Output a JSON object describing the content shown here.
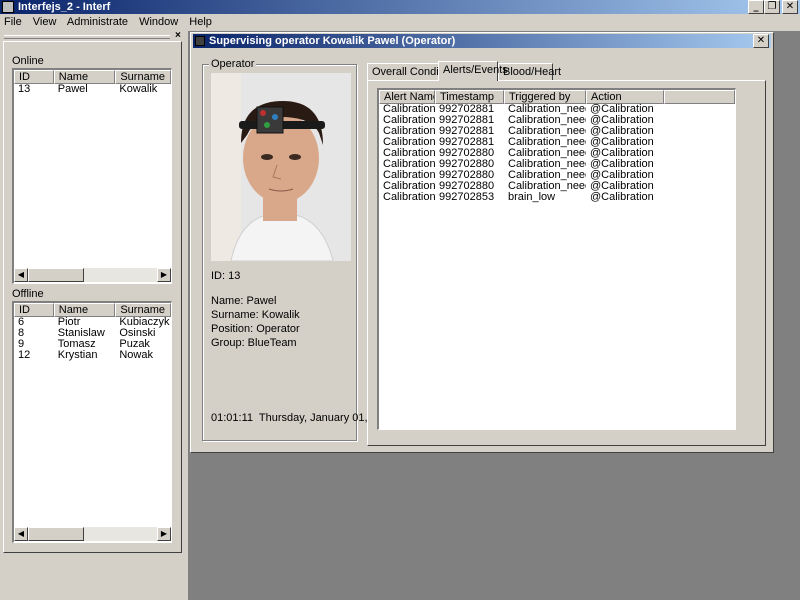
{
  "app": {
    "title": "Interfejs_2 - Interf",
    "controls": [
      "_",
      "❐",
      "✕"
    ]
  },
  "menu": {
    "file": "File",
    "view": "View",
    "administrate": "Administrate",
    "window": "Window",
    "help": "Help"
  },
  "sidebar": {
    "close": "×",
    "online": {
      "label": "Online",
      "columns": [
        "ID",
        "Name",
        "Surname"
      ],
      "rows": [
        {
          "id": "13",
          "name": "Pawel",
          "surname": "Kowalik"
        }
      ]
    },
    "offline": {
      "label": "Offline",
      "columns": [
        "ID",
        "Name",
        "Surname"
      ],
      "rows": [
        {
          "id": "6",
          "name": "Piotr",
          "surname": "Kubiaczyk"
        },
        {
          "id": "8",
          "name": "Stanislaw",
          "surname": "Osinski"
        },
        {
          "id": "9",
          "name": "Tomasz",
          "surname": "Puzak"
        },
        {
          "id": "12",
          "name": "Krystian",
          "surname": "Nowak"
        }
      ]
    }
  },
  "child_window": {
    "title": "Supervising operator Kowalik Pawel (Operator)",
    "close": "✕",
    "operator": {
      "group_label": "Operator",
      "id": "ID: 13",
      "name": "Name: Pawel",
      "surname": "Surname: Kowalik",
      "position": "Position: Operator",
      "group": "Group: BlueTeam",
      "clock": "01:01:11  Thursday, January 01,"
    },
    "tabs": [
      {
        "label": "Overall Condition",
        "active": false
      },
      {
        "label": "Alerts/Events",
        "active": true
      },
      {
        "label": "Blood/Heart",
        "active": false
      }
    ],
    "alerts": {
      "columns": [
        "Alert Name",
        "Timestamp",
        "Triggered by",
        "Action"
      ],
      "rows": [
        [
          "Calibration",
          "992702881",
          "Calibration_need",
          "@Calibration"
        ],
        [
          "Calibration",
          "992702881",
          "Calibration_need",
          "@Calibration"
        ],
        [
          "Calibration",
          "992702881",
          "Calibration_need",
          "@Calibration"
        ],
        [
          "Calibration",
          "992702881",
          "Calibration_need",
          "@Calibration"
        ],
        [
          "Calibration",
          "992702880",
          "Calibration_need",
          "@Calibration"
        ],
        [
          "Calibration",
          "992702880",
          "Calibration_need",
          "@Calibration"
        ],
        [
          "Calibration",
          "992702880",
          "Calibration_need",
          "@Calibration"
        ],
        [
          "Calibration",
          "992702880",
          "Calibration_need",
          "@Calibration"
        ],
        [
          "Calibration",
          "992702853",
          "brain_low",
          "@Calibration"
        ]
      ]
    }
  },
  "colors": {
    "titlebar_start": "#0a246a",
    "titlebar_end": "#a6caf0",
    "mdi_background": "#808080",
    "face": "#d4d0c8"
  }
}
